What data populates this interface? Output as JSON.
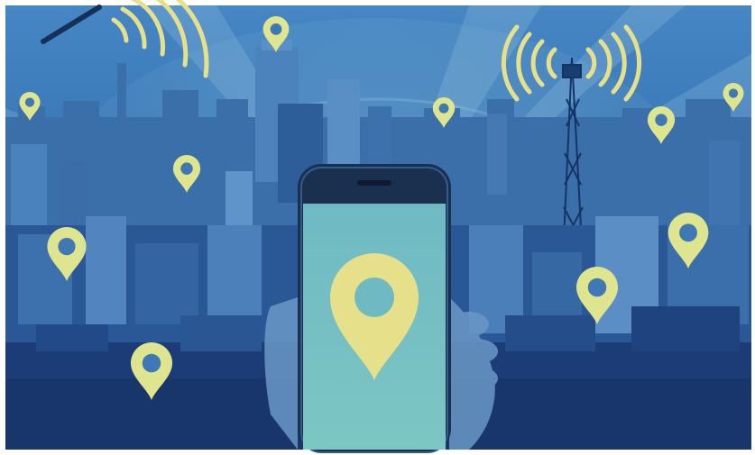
{
  "scene": {
    "subject": "smartphone-with-location-pin",
    "background": "city-skyline",
    "colors": {
      "sky_top": "#3f7fbf",
      "sky_mid": "#2f6fae",
      "city_dark": "#1e3f7a",
      "city_mid": "#2b5c9e",
      "city_light": "#4f8bc4",
      "accent_yellow": "#e6e08a",
      "screen": "#74c1c6",
      "phone_body": "#1b2f4f",
      "hand": "#6d9bc8",
      "frame": "#ffffff"
    },
    "icons": {
      "main_pin": "map-pin-icon",
      "small_pins": "map-pin-icon",
      "signals": "wifi-signal-icon",
      "tower": "radio-tower-icon"
    }
  }
}
